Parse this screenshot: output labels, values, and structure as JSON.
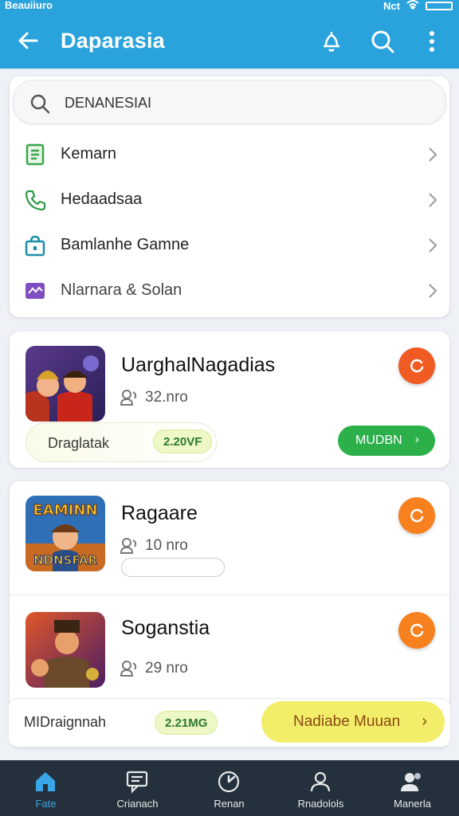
{
  "status_bar": {
    "left_text": "Beauiiuro",
    "right_text": "Nct"
  },
  "app_bar": {
    "title": "Daparasia"
  },
  "search": {
    "value": "DENANESIAI"
  },
  "menu": [
    {
      "label": "Kemarn",
      "icon": "document-icon",
      "color": "#3aa54a"
    },
    {
      "label": "Hedaadsaa",
      "icon": "phone-icon",
      "color": "#2e9a48"
    },
    {
      "label": "Bamlanhe Gamne",
      "icon": "shop-bag-icon",
      "color": "#1b8fa8"
    },
    {
      "label": "Nlarnara & Solan",
      "icon": "mail-image-icon",
      "color": "#7e4fc0"
    }
  ],
  "games": [
    {
      "name": "UarghalNagadias",
      "meta": "32.nro",
      "footer_label": "Draglatak",
      "size": "2.20VF",
      "action": "MUDBN"
    },
    {
      "name": "Ragaare",
      "meta": "10 nro",
      "thumb_text_top": "EAMINN",
      "thumb_text_bottom": "NDNSFAR"
    },
    {
      "name": "Soganstia",
      "meta": "29 nro",
      "footer_label": "MIDraignnah",
      "size": "2.21MG",
      "action": "Nadiabe Muuan"
    }
  ],
  "bottom_nav": [
    {
      "label": "Fate",
      "icon": "home-icon",
      "active": true
    },
    {
      "label": "Crianach",
      "icon": "chat-icon",
      "active": false
    },
    {
      "label": "Renan",
      "icon": "compass-icon",
      "active": false
    },
    {
      "label": "Rnadolols",
      "icon": "profile-icon",
      "active": false
    },
    {
      "label": "Manerla",
      "icon": "people-icon",
      "active": false
    }
  ],
  "colors": {
    "primary": "#2aa3dd",
    "action_orange": "#f05a23",
    "action_green": "#2bb04a",
    "nav_bg": "#24303b"
  }
}
